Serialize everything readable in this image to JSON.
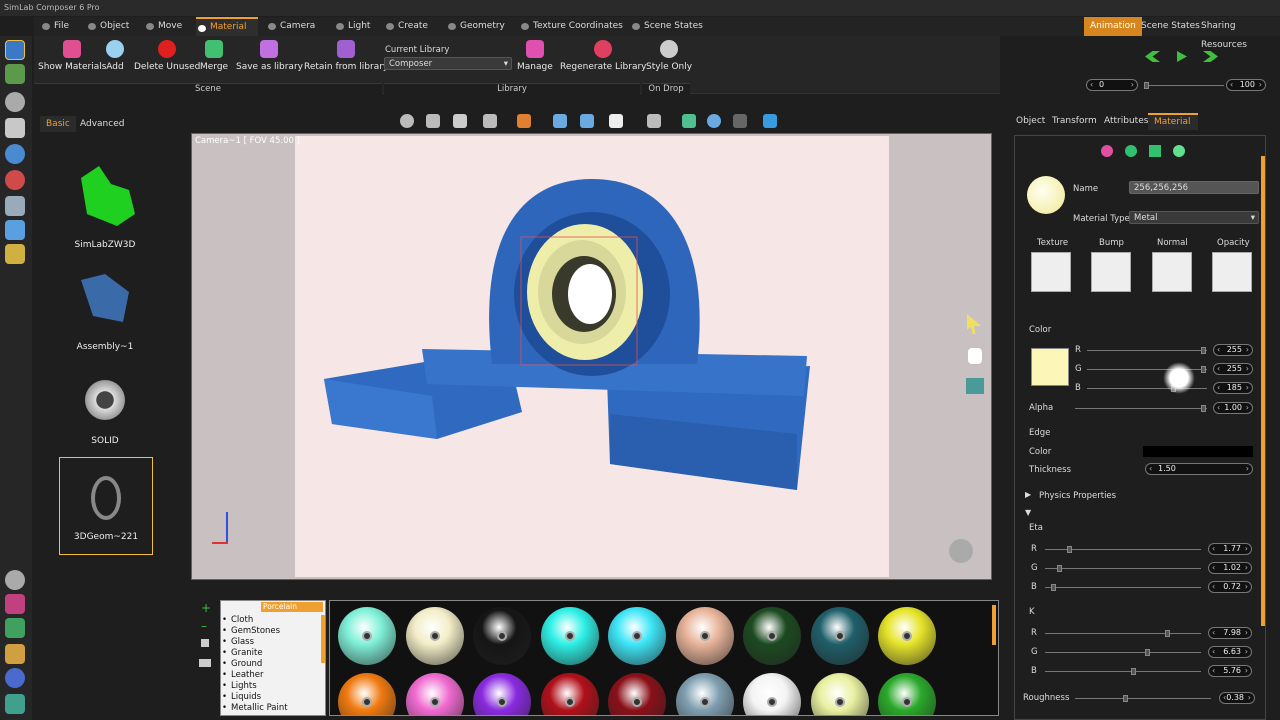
{
  "app": {
    "title": "SimLab Composer 6 Pro"
  },
  "menu": {
    "items": [
      "File",
      "Object",
      "Move",
      "Material",
      "Camera",
      "Light",
      "Create",
      "Geometry",
      "Texture Coordinates",
      "Scene States"
    ],
    "active": "Material"
  },
  "right_tabs": {
    "items": [
      "Animation",
      "Scene States",
      "Sharing Resources"
    ],
    "active": "Animation"
  },
  "ribbon": {
    "tools": [
      "Show Materials",
      "Add",
      "Delete Unused",
      "Merge",
      "Save as library",
      "Retain from library",
      "Manage",
      "Regenerate Library",
      "Style Only"
    ],
    "current_library_label": "Current Library",
    "current_library_value": "Composer",
    "groups": [
      "Scene",
      "Library",
      "On Drop"
    ]
  },
  "animation": {
    "start": "0",
    "end": "100"
  },
  "library": {
    "tabs": [
      "Basic",
      "Advanced"
    ],
    "items": [
      {
        "label": "SimLabZW3D"
      },
      {
        "label": "Assembly~1"
      },
      {
        "label": "SOLID"
      },
      {
        "label": "3DGeom~221"
      }
    ]
  },
  "viewport": {
    "camera_label": "Camera~1 [ FOV 45.00 ]"
  },
  "materials": {
    "selected_category": "Porcelain",
    "categories": [
      "Cloth",
      "GemStones",
      "Glass",
      "Granite",
      "Ground",
      "Leather",
      "Lights",
      "Liquids",
      "Metallic Paint"
    ],
    "swatch_colors": [
      "#7ff0d8",
      "#f3eec8",
      "#151515",
      "#2ef0e6",
      "#3ee6f7",
      "#e8b49a",
      "#1c4a20",
      "#1f5f6a",
      "#e6e42a",
      "#f07a10",
      "#f06ad0",
      "#8a2ae0",
      "#b0101a",
      "#8a1018",
      "#7f9eb0",
      "#f4f4f4",
      "#e8f0a0",
      "#2aa82a"
    ]
  },
  "properties": {
    "tabs": [
      "Object",
      "Transform",
      "Attributes",
      "Material"
    ],
    "active": "Material",
    "name_label": "Name",
    "name_value": "256,256,256",
    "material_type_label": "Material Type",
    "material_type_value": "Metal",
    "maps": [
      "Texture",
      "Bump",
      "Normal",
      "Opacity"
    ],
    "color_section": "Color",
    "color": {
      "r": "255",
      "g": "255",
      "b": "185",
      "alpha": "1.00"
    },
    "swatch": "#fcf7b9",
    "edge_section": "Edge",
    "edge_color_label": "Color",
    "edge_color": "#000000",
    "thickness_label": "Thickness",
    "thickness": "1.50",
    "physics_label": "Physics Properties",
    "eta_label": "Eta",
    "eta": {
      "r": "1.77",
      "g": "1.02",
      "b": "0.72"
    },
    "k_label": "K",
    "k": {
      "r": "7.98",
      "g": "6.63",
      "b": "5.76"
    },
    "roughness_label": "Roughness",
    "roughness": "0.38",
    "channel_labels": [
      "R",
      "G",
      "B"
    ],
    "alpha_label": "Alpha"
  }
}
